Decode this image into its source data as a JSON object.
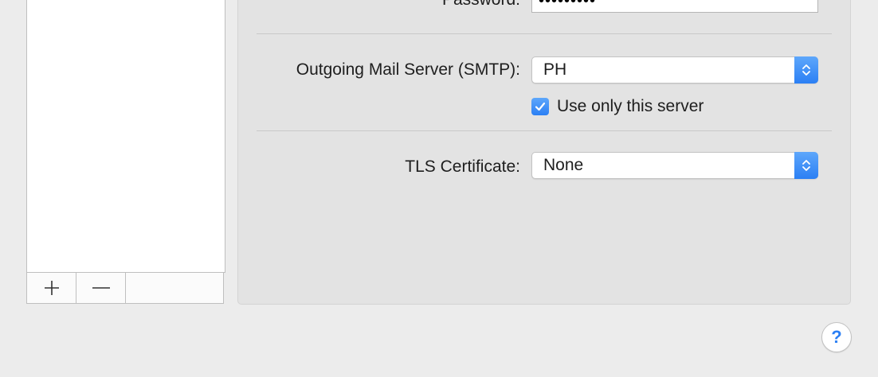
{
  "accounts_list": {
    "add_symbol": "+",
    "remove_symbol": "−"
  },
  "form": {
    "password_label": "Password:",
    "password_value": "•••••••••",
    "smtp_label": "Outgoing Mail Server (SMTP):",
    "smtp_value": "PH",
    "use_only_label": "Use only this server",
    "use_only_checked": true,
    "tls_label": "TLS Certificate:",
    "tls_value": "None"
  },
  "help": {
    "symbol": "?"
  },
  "colors": {
    "accent": "#2b7ff4",
    "panel": "#e3e3e3",
    "window": "#ececec"
  },
  "icons": {
    "add": "plus-icon",
    "remove": "minus-icon",
    "stepper": "up-down-chevron-icon",
    "check": "checkmark-icon",
    "help": "question-mark-icon"
  }
}
